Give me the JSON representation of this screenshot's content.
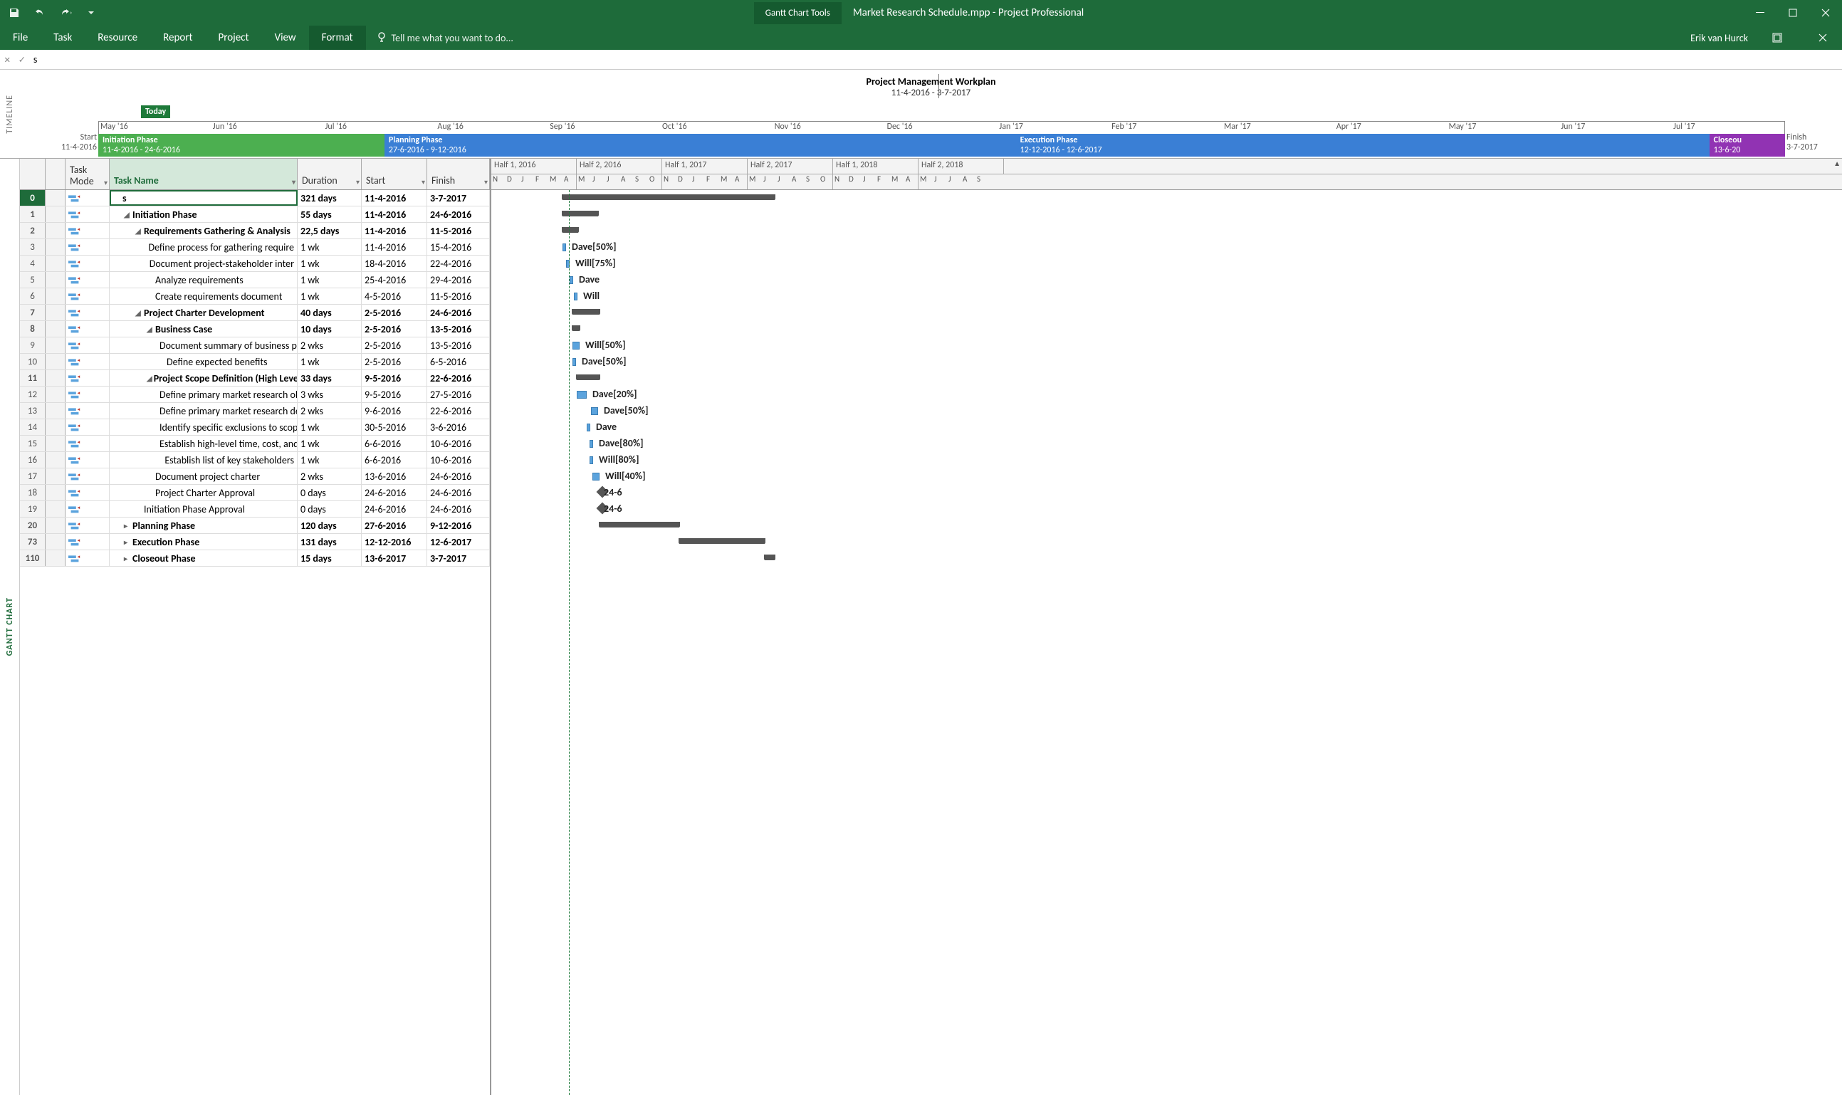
{
  "titlebar": {
    "tools_label": "Gantt Chart Tools",
    "app_title": "Market Research Schedule.mpp - Project Professional"
  },
  "tabs": {
    "items": [
      "File",
      "Task",
      "Resource",
      "Report",
      "Project",
      "View",
      "Format"
    ],
    "selected": "Format",
    "tellme": "Tell me what you want to do..."
  },
  "user": {
    "name": "Erik van Hurck"
  },
  "formulabar": {
    "value": "s"
  },
  "timeline": {
    "label": "TIMELINE",
    "title": "Project Management Workplan",
    "subtitle": "11-4-2016 - 3-7-2017",
    "today": "Today",
    "start_label": "Start",
    "start_date": "11-4-2016",
    "finish_label": "Finish",
    "finish_date": "3-7-2017",
    "months": [
      "May '16",
      "Jun '16",
      "Jul '16",
      "Aug '16",
      "Sep '16",
      "Oct '16",
      "Nov '16",
      "Dec '16",
      "Jan '17",
      "Feb '17",
      "Mar '17",
      "Apr '17",
      "May '17",
      "Jun '17",
      "Jul '17"
    ],
    "bars": [
      {
        "name": "Initiation Phase",
        "dates": "11-4-2016 - 24-6-2016",
        "color": "#4caf50",
        "width": 17
      },
      {
        "name": "Planning Phase",
        "dates": "27-6-2016 - 9-12-2016",
        "color": "#3a7fd5",
        "width": 37
      },
      {
        "name": "",
        "dates": "",
        "color": "#3a7fd5",
        "width": 0.3
      },
      {
        "name": "Execution Phase",
        "dates": "12-12-2016 - 12-6-2017",
        "color": "#3a7fd5",
        "width": 41.2
      },
      {
        "name": "Closeou",
        "dates": "13-6-20",
        "color": "#9133b3",
        "width": 4.5
      }
    ]
  },
  "gantt_label": "GANTT CHART",
  "columns": {
    "mode": "Task\nMode",
    "name": "Task Name",
    "duration": "Duration",
    "start": "Start",
    "finish": "Finish"
  },
  "chart_header": {
    "halves": [
      "Half 1, 2016",
      "Half 2, 2016",
      "Half 1, 2017",
      "Half 2, 2017",
      "Half 1, 2018",
      "Half 2, 2018"
    ],
    "months": [
      "N",
      "D",
      "J",
      "F",
      "M",
      "A",
      "M",
      "J",
      "J",
      "A",
      "S",
      "O",
      "N",
      "D",
      "J",
      "F",
      "M",
      "A",
      "M",
      "J",
      "J",
      "A",
      "S",
      "O",
      "N",
      "D",
      "J",
      "F",
      "M",
      "A",
      "M",
      "J",
      "J",
      "A",
      "S"
    ]
  },
  "rows": [
    {
      "id": "0",
      "bold": true,
      "indent": 0,
      "expand": "",
      "name": "s",
      "dur": "321 days",
      "start": "11-4-2016",
      "finish": "3-7-2017",
      "bar": "summary",
      "bl": 100,
      "bw": 298,
      "label": "",
      "editing": true
    },
    {
      "id": "1",
      "bold": true,
      "indent": 1,
      "expand": "◢",
      "name": "Initiation Phase",
      "dur": "55 days",
      "start": "11-4-2016",
      "finish": "24-6-2016",
      "bar": "summary",
      "bl": 100,
      "bw": 50,
      "label": ""
    },
    {
      "id": "2",
      "bold": true,
      "indent": 2,
      "expand": "◢",
      "name": "Requirements Gathering & Analysis",
      "dur": "22,5 days",
      "start": "11-4-2016",
      "finish": "11-5-2016",
      "bar": "summary",
      "bl": 100,
      "bw": 22,
      "label": ""
    },
    {
      "id": "3",
      "bold": false,
      "indent": 3,
      "expand": "",
      "name": "Define process for gathering require",
      "dur": "1 wk",
      "start": "11-4-2016",
      "finish": "15-4-2016",
      "bar": "task",
      "bl": 100,
      "bw": 5,
      "label": "Dave[50%]"
    },
    {
      "id": "4",
      "bold": false,
      "indent": 3,
      "expand": "",
      "name": "Document project-stakeholder inter",
      "dur": "1 wk",
      "start": "18-4-2016",
      "finish": "22-4-2016",
      "bar": "task",
      "bl": 105,
      "bw": 5,
      "label": "Will[75%]"
    },
    {
      "id": "5",
      "bold": false,
      "indent": 3,
      "expand": "",
      "name": "Analyze requirements",
      "dur": "1 wk",
      "start": "25-4-2016",
      "finish": "29-4-2016",
      "bar": "task",
      "bl": 110,
      "bw": 5,
      "label": "Dave"
    },
    {
      "id": "6",
      "bold": false,
      "indent": 3,
      "expand": "",
      "name": "Create requirements document",
      "dur": "1 wk",
      "start": "4-5-2016",
      "finish": "11-5-2016",
      "bar": "task",
      "bl": 116,
      "bw": 5,
      "label": "Will"
    },
    {
      "id": "7",
      "bold": true,
      "indent": 2,
      "expand": "◢",
      "name": "Project Charter Development",
      "dur": "40 days",
      "start": "2-5-2016",
      "finish": "24-6-2016",
      "bar": "summary",
      "bl": 114,
      "bw": 38,
      "label": ""
    },
    {
      "id": "8",
      "bold": true,
      "indent": 3,
      "expand": "◢",
      "name": "Business Case",
      "dur": "10 days",
      "start": "2-5-2016",
      "finish": "13-5-2016",
      "bar": "summary",
      "bl": 114,
      "bw": 10,
      "label": ""
    },
    {
      "id": "9",
      "bold": false,
      "indent": 4,
      "expand": "",
      "name": "Document summary of business pr",
      "dur": "2 wks",
      "start": "2-5-2016",
      "finish": "13-5-2016",
      "bar": "task",
      "bl": 114,
      "bw": 10,
      "label": "Will[50%]"
    },
    {
      "id": "10",
      "bold": false,
      "indent": 4,
      "expand": "",
      "name": "Define expected benefits",
      "dur": "1 wk",
      "start": "2-5-2016",
      "finish": "6-5-2016",
      "bar": "task",
      "bl": 114,
      "bw": 5,
      "label": "Dave[50%]"
    },
    {
      "id": "11",
      "bold": true,
      "indent": 3,
      "expand": "◢",
      "name": "Project Scope Definition (High Leve",
      "dur": "33 days",
      "start": "9-5-2016",
      "finish": "22-6-2016",
      "bar": "summary",
      "bl": 120,
      "bw": 32,
      "label": ""
    },
    {
      "id": "12",
      "bold": false,
      "indent": 4,
      "expand": "",
      "name": "Define primary market research ob",
      "dur": "3 wks",
      "start": "9-5-2016",
      "finish": "27-5-2016",
      "bar": "task",
      "bl": 120,
      "bw": 14,
      "label": "Dave[20%]"
    },
    {
      "id": "13",
      "bold": false,
      "indent": 4,
      "expand": "",
      "name": "Define primary market research de",
      "dur": "2 wks",
      "start": "9-6-2016",
      "finish": "22-6-2016",
      "bar": "task",
      "bl": 140,
      "bw": 10,
      "label": "Dave[50%]"
    },
    {
      "id": "14",
      "bold": false,
      "indent": 4,
      "expand": "",
      "name": "Identify specific exclusions to scop",
      "dur": "1 wk",
      "start": "30-5-2016",
      "finish": "3-6-2016",
      "bar": "task",
      "bl": 134,
      "bw": 5,
      "label": "Dave"
    },
    {
      "id": "15",
      "bold": false,
      "indent": 4,
      "expand": "",
      "name": "Establish high-level time, cost, and r",
      "dur": "1 wk",
      "start": "6-6-2016",
      "finish": "10-6-2016",
      "bar": "task",
      "bl": 138,
      "bw": 5,
      "label": "Dave[80%]"
    },
    {
      "id": "16",
      "bold": false,
      "indent": 4,
      "expand": "",
      "name": "Establish list of key stakeholders",
      "dur": "1 wk",
      "start": "6-6-2016",
      "finish": "10-6-2016",
      "bar": "task",
      "bl": 138,
      "bw": 5,
      "label": "Will[80%]"
    },
    {
      "id": "17",
      "bold": false,
      "indent": 3,
      "expand": "",
      "name": "Document project charter",
      "dur": "2 wks",
      "start": "13-6-2016",
      "finish": "24-6-2016",
      "bar": "task",
      "bl": 142,
      "bw": 10,
      "label": "Will[40%]"
    },
    {
      "id": "18",
      "bold": false,
      "indent": 3,
      "expand": "",
      "name": "Project Charter Approval",
      "dur": "0 days",
      "start": "24-6-2016",
      "finish": "24-6-2016",
      "bar": "milestone",
      "bl": 150,
      "bw": 0,
      "label": "24-6"
    },
    {
      "id": "19",
      "bold": false,
      "indent": 2,
      "expand": "",
      "name": "Initiation Phase Approval",
      "dur": "0 days",
      "start": "24-6-2016",
      "finish": "24-6-2016",
      "bar": "milestone",
      "bl": 150,
      "bw": 0,
      "label": "24-6"
    },
    {
      "id": "20",
      "bold": true,
      "indent": 1,
      "expand": "▸",
      "name": "Planning Phase",
      "dur": "120 days",
      "start": "27-6-2016",
      "finish": "9-12-2016",
      "bar": "summary",
      "bl": 152,
      "bw": 112,
      "label": ""
    },
    {
      "id": "73",
      "bold": true,
      "indent": 1,
      "expand": "▸",
      "name": "Execution Phase",
      "dur": "131 days",
      "start": "12-12-2016",
      "finish": "12-6-2017",
      "bar": "summary",
      "bl": 264,
      "bw": 120,
      "label": ""
    },
    {
      "id": "110",
      "bold": true,
      "indent": 1,
      "expand": "▸",
      "name": "Closeout Phase",
      "dur": "15 days",
      "start": "13-6-2017",
      "finish": "3-7-2017",
      "bar": "summary",
      "bl": 384,
      "bw": 14,
      "label": ""
    }
  ]
}
